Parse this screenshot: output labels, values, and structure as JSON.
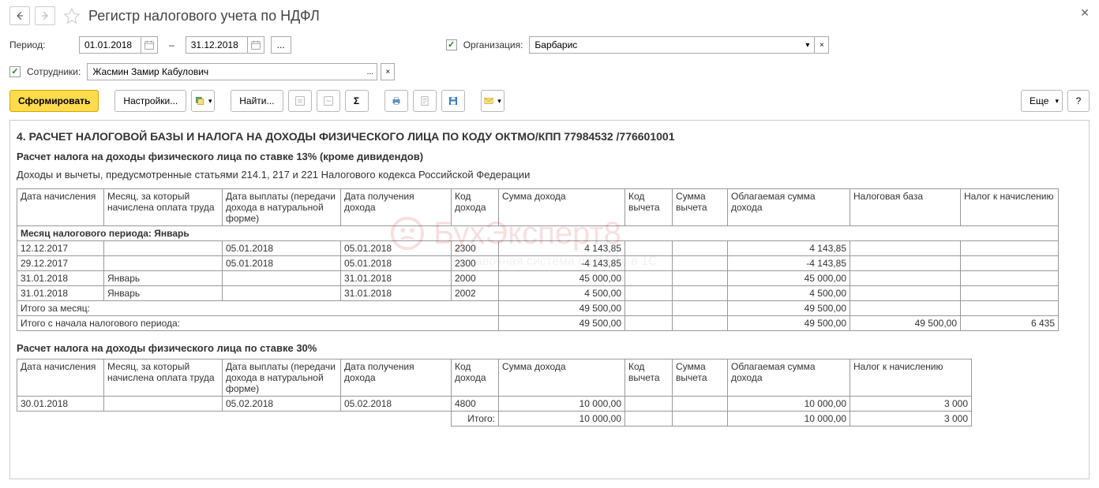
{
  "header": {
    "title": "Регистр налогового учета по НДФЛ"
  },
  "period": {
    "label": "Период:",
    "from": "01.01.2018",
    "to": "31.12.2018",
    "dash": "–"
  },
  "org": {
    "checkbox_label": "Организация:",
    "value": "Барбарис"
  },
  "employees": {
    "checkbox_label": "Сотрудники:",
    "value": "Жасмин Замир Кабулович"
  },
  "toolbar": {
    "generate": "Сформировать",
    "settings": "Настройки...",
    "find": "Найти...",
    "more": "Еще",
    "help": "?"
  },
  "report": {
    "section_title": "4. РАСЧЕТ НАЛОГОВОЙ БАЗЫ И НАЛОГА НА ДОХОДЫ ФИЗИЧЕСКОГО ЛИЦА ПО КОДУ ОКТМО/КПП 77984532   /776601001",
    "sub13": "Расчет налога на доходы физического лица по ставке 13% (кроме дивидендов)",
    "note": "Доходы и вычеты, предусмотренные статьями 214.1, 217 и 221 Налогового кодекса Российской Федерации",
    "sub30": "Расчет налога на доходы физического лица по ставке 30%",
    "headers": {
      "h1": "Дата начисления",
      "h2": "Месяц, за который начислена оплата труда",
      "h3": "Дата выплаты (передачи дохода в натуральной форме)",
      "h4": "Дата получения дохода",
      "h5": "Код дохода",
      "h6": "Сумма дохода",
      "h7": "Код вычета",
      "h8": "Сумма вычета",
      "h9": "Облагаемая сумма дохода",
      "h10": "Налоговая база",
      "h11": "Налог к начислению"
    },
    "month_row": "Месяц налогового периода: Январь",
    "rows13": [
      {
        "d": "12.12.2017",
        "m": "",
        "pay": "05.01.2018",
        "rec": "05.01.2018",
        "code": "2300",
        "sum": "4 143,85",
        "vcode": "",
        "vsum": "",
        "tax": "4 143,85",
        "base": "",
        "due": ""
      },
      {
        "d": "29.12.2017",
        "m": "",
        "pay": "05.01.2018",
        "rec": "05.01.2018",
        "code": "2300",
        "sum": "-4 143,85",
        "vcode": "",
        "vsum": "",
        "tax": "-4 143,85",
        "base": "",
        "due": ""
      },
      {
        "d": "31.01.2018",
        "m": "Январь",
        "pay": "",
        "rec": "31.01.2018",
        "code": "2000",
        "sum": "45 000,00",
        "vcode": "",
        "vsum": "",
        "tax": "45 000,00",
        "base": "",
        "due": ""
      },
      {
        "d": "31.01.2018",
        "m": "Январь",
        "pay": "",
        "rec": "31.01.2018",
        "code": "2002",
        "sum": "4 500,00",
        "vcode": "",
        "vsum": "",
        "tax": "4 500,00",
        "base": "",
        "due": ""
      }
    ],
    "total_month": {
      "label": "Итого за месяц:",
      "sum": "49 500,00",
      "tax": "49 500,00"
    },
    "total_period": {
      "label": "Итого с начала налогового периода:",
      "sum": "49 500,00",
      "tax": "49 500,00",
      "base": "49 500,00",
      "due": "6 435"
    },
    "rows30": [
      {
        "d": "30.01.2018",
        "m": "",
        "pay": "05.02.2018",
        "rec": "05.02.2018",
        "code": "4800",
        "sum": "10 000,00",
        "vcode": "",
        "vsum": "",
        "tax": "10 000,00",
        "base": "",
        "due": "3 000"
      }
    ],
    "total30": {
      "label": "Итого:",
      "sum": "10 000,00",
      "tax": "10 000,00",
      "due": "3 000"
    }
  },
  "watermark": {
    "text": "БухЭксперт8",
    "sub": "Справочная система по учету в 1С"
  }
}
